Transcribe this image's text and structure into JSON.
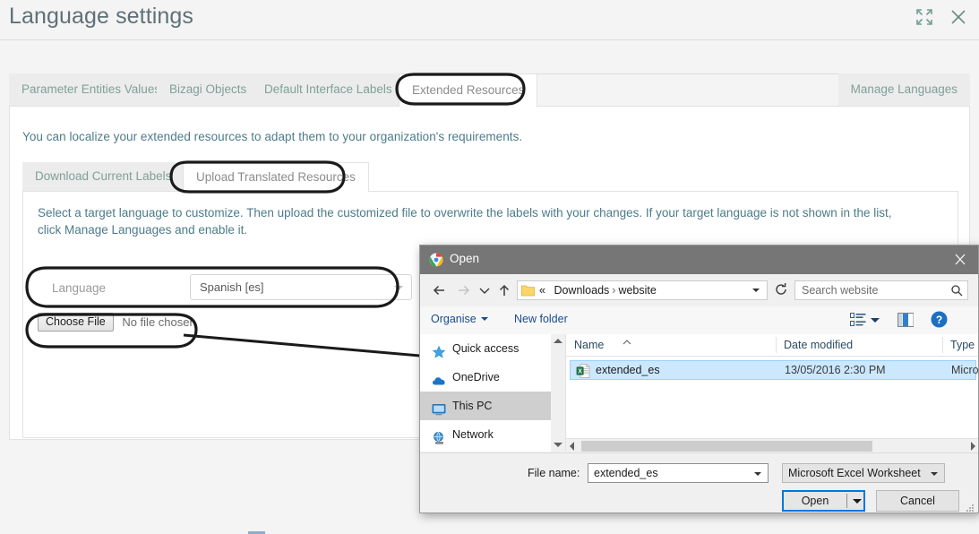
{
  "header": {
    "title": "Language settings",
    "expand_icon": "expand-icon",
    "close_icon": "close-icon"
  },
  "main_tabs": {
    "items": [
      {
        "label": "Parameter Entities Values",
        "active": false
      },
      {
        "label": "Bizagi Objects",
        "active": false
      },
      {
        "label": "Default Interface Labels",
        "active": false
      },
      {
        "label": "Extended Resources",
        "active": true
      }
    ],
    "right_item": {
      "label": "Manage Languages"
    }
  },
  "content": {
    "intro": "You can localize your extended resources to adapt them to your organization's requirements."
  },
  "sub_tabs": {
    "items": [
      {
        "label": "Download Current Labels",
        "active": false
      },
      {
        "label": "Upload Translated Resources",
        "active": true
      }
    ]
  },
  "upload_panel": {
    "instructions": "Select a target language to customize. Then upload the customized file to overwrite the labels with your changes. If your target language is not shown in the list, click Manage Languages and enable it.",
    "language_label": "Language",
    "language_value": "Spanish [es]",
    "choose_file_label": "Choose File",
    "no_file_chosen": "No file chosen"
  },
  "open_dialog": {
    "title": "Open",
    "app_icon": "chrome-icon",
    "close_icon": "close-icon",
    "nav": {
      "back_icon": "back-arrow-icon",
      "forward_icon": "forward-arrow-icon",
      "recent_icon": "chevron-down-icon",
      "up_icon": "up-arrow-icon",
      "refresh_icon": "refresh-icon"
    },
    "address": {
      "folder_icon": "folder-icon",
      "prefix": "«",
      "crumb1": "Downloads",
      "separator": "›",
      "crumb2": "website"
    },
    "search": {
      "placeholder": "Search website",
      "icon": "search-icon"
    },
    "toolbar": {
      "organise_label": "Organise",
      "new_folder_label": "New folder",
      "view_options_icon": "view-options-icon",
      "preview_pane_icon": "preview-pane-icon",
      "help_icon": "help-icon"
    },
    "sidebar": [
      {
        "label": "Quick access",
        "icon": "star-icon",
        "selected": false
      },
      {
        "label": "OneDrive",
        "icon": "cloud-icon",
        "selected": false
      },
      {
        "label": "This PC",
        "icon": "monitor-icon",
        "selected": true
      },
      {
        "label": "Network",
        "icon": "globe-icon",
        "selected": false
      }
    ],
    "columns": [
      "Name",
      "Date modified",
      "Type"
    ],
    "files": [
      {
        "name": "extended_es",
        "date_modified": "13/05/2016 2:30 PM",
        "type": "Microsoft",
        "icon": "excel-file-icon",
        "selected": true
      }
    ],
    "footer": {
      "filename_label": "File name:",
      "filename_value": "extended_es",
      "filetype_value": "Microsoft Excel Worksheet",
      "open_label": "Open",
      "cancel_label": "Cancel"
    }
  },
  "annotations": {
    "ellipse_tab": "Extended Resources",
    "ellipse_subtab": "Upload Translated Resources",
    "ellipse_language": "Language row",
    "ellipse_choose_file": "Choose File",
    "arrow_target": "extended_es file row"
  },
  "colors": {
    "tab_text": "#7fa098",
    "title_text": "#5f7078",
    "body_text": "#4c7b8a",
    "selection_blue": "#cce8ff",
    "focus_blue": "#0078d7",
    "annotation_black": "#1a1a1a"
  }
}
